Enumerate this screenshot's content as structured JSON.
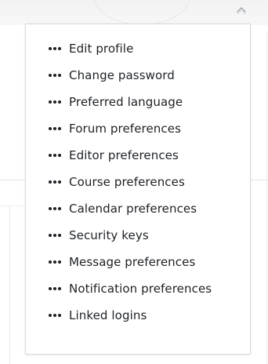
{
  "menu": {
    "items": [
      {
        "label": "Edit profile",
        "icon": "dots-icon"
      },
      {
        "label": "Change password",
        "icon": "dots-icon"
      },
      {
        "label": "Preferred language",
        "icon": "dots-icon"
      },
      {
        "label": "Forum preferences",
        "icon": "dots-icon"
      },
      {
        "label": "Editor preferences",
        "icon": "dots-icon"
      },
      {
        "label": "Course preferences",
        "icon": "dots-icon"
      },
      {
        "label": "Calendar preferences",
        "icon": "dots-icon"
      },
      {
        "label": "Security keys",
        "icon": "dots-icon"
      },
      {
        "label": "Message preferences",
        "icon": "dots-icon"
      },
      {
        "label": "Notification preferences",
        "icon": "dots-icon"
      },
      {
        "label": "Linked logins",
        "icon": "dots-icon"
      }
    ]
  },
  "colors": {
    "text": "#1d2125",
    "border": "#d9d9d9",
    "background": "#ffffff"
  }
}
